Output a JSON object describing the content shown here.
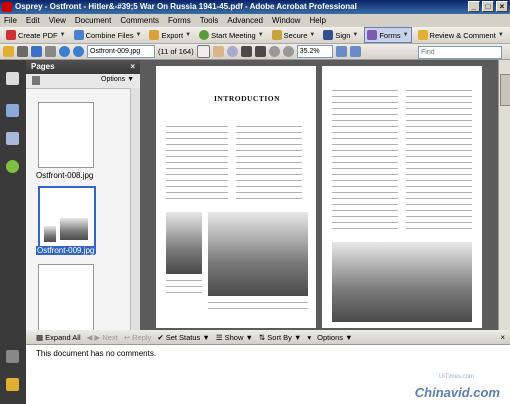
{
  "window": {
    "title": "Osprey - Ostfront - Hitler&-#39;5 War On Russia 1941-45.pdf - Adobe Acrobat Professional"
  },
  "menu": [
    "File",
    "Edit",
    "View",
    "Document",
    "Comments",
    "Forms",
    "Tools",
    "Advanced",
    "Window",
    "Help"
  ],
  "toolbar1": {
    "create_pdf": "Create PDF",
    "combine": "Combine Files",
    "export": "Export",
    "meeting": "Start Meeting",
    "secure": "Secure",
    "sign": "Sign",
    "forms": "Forms",
    "review": "Review & Comment"
  },
  "toolbar2": {
    "page_field": "Ostfront-009.jpg",
    "page_count": "(11 of 164)",
    "zoom": "35.2%",
    "find_placeholder": "Find"
  },
  "pages_panel": {
    "title": "Pages",
    "options": "Options",
    "thumbs": [
      "Ostfront-008.jpg",
      "Ostfront-009.jpg"
    ]
  },
  "document": {
    "heading": "INTRODUCTION"
  },
  "comments": {
    "expand_all": "Expand All",
    "next": "Next",
    "reply": "Reply",
    "set_status": "Set Status",
    "show": "Show",
    "sort_by": "Sort By",
    "options": "Options",
    "message": "This document has no comments."
  },
  "watermark": {
    "main": "Chinavid.com",
    "small": "UITimes.com"
  }
}
